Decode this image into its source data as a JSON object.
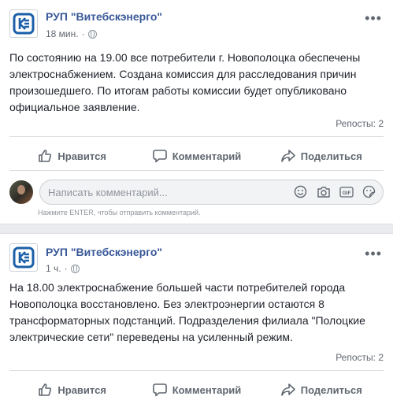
{
  "posts": [
    {
      "page_name": "РУП \"Витебскэнерго\"",
      "time": "18 мин.",
      "text": "По состоянию на 19.00 все потребители г. Новополоцка обеспечены электроснабжением. Создана комиссия для расследования причин произошедшего. По итогам работы комиссии будет опубликовано официальное заявление.",
      "reposts": "Репосты: 2"
    },
    {
      "page_name": "РУП \"Витебскэнерго\"",
      "time": "1 ч.",
      "text": "На 18.00 электроснабжение большей части потребителей города Новополоцка восстановлено. Без электроэнергии остаются 8 трансформаторных подстанций. Подразделения филиала \"Полоцкие электрические сети\" переведены на усиленный режим.",
      "reposts": "Репосты: 2"
    }
  ],
  "actions": {
    "like": "Нравится",
    "comment": "Комментарий",
    "share": "Поделиться"
  },
  "comment": {
    "placeholder": "Написать комментарий...",
    "hint": "Нажмите ENTER, чтобы отправить комментарий.",
    "gif_label": "GIF"
  },
  "colors": {
    "link": "#385898",
    "logo": "#1b5fa8"
  },
  "icons": [
    "options-icon",
    "globe-icon",
    "like-icon",
    "comment-icon",
    "share-icon",
    "emoji-icon",
    "camera-icon",
    "gif-icon",
    "sticker-icon"
  ]
}
